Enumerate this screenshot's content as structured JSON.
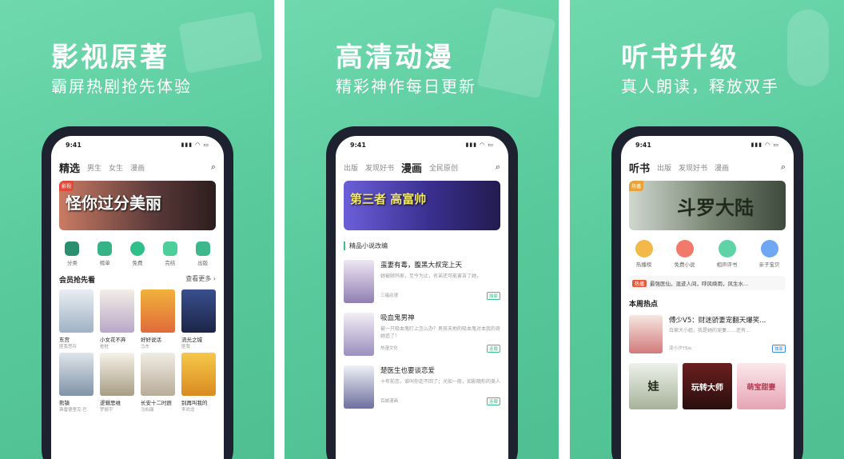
{
  "panels": [
    {
      "headline": "影视原著",
      "subtitle": "霸屏热剧抢先体验",
      "phone": {
        "time": "9:41",
        "tabs": [
          "精选",
          "男生",
          "女生",
          "漫画"
        ],
        "banner_text": "怪你过分美丽",
        "banner_tag": "影视",
        "shortcuts": [
          "分类",
          "榜单",
          "免费",
          "完结",
          "出版"
        ],
        "section_title": "会员抢先看",
        "section_more": "查看更多 ›",
        "books": [
          {
            "title": "东宫",
            "author": "匪我思存"
          },
          {
            "title": "小女花不弃",
            "author": "桩桩"
          },
          {
            "title": "好好说话",
            "author": "马东"
          },
          {
            "title": "流光之城",
            "author": "匪我"
          },
          {
            "title": "熊镇",
            "author": "弗雷德里克·巴"
          },
          {
            "title": "逻辑思维",
            "author": "罗振宇"
          },
          {
            "title": "长安十二时辰",
            "author": "马伯庸"
          },
          {
            "title": "别再叫我的",
            "author": "李尚龙"
          }
        ]
      }
    },
    {
      "headline": "高清动漫",
      "subtitle": "精彩神作每日更新",
      "phone": {
        "time": "9:41",
        "tabs": [
          "出版",
          "发现好书",
          "漫画",
          "全民原创"
        ],
        "banner_text": "第三者 高富帅",
        "list_title": "精品小说改编",
        "items": [
          {
            "title": "蛮妻有毒，腹黑大叔宠上天",
            "desc": "她被顾玛家，至今为止，名弟还可能害苦了她，",
            "publisher": "三福动漫",
            "badge": "独家"
          },
          {
            "title": "吸血鬼男神",
            "desc": "被一只吸血鬼盯上怎么办？男孩天地的吸血鬼对本我的奇她追了！",
            "publisher": "热漫文化",
            "badge": "连载"
          },
          {
            "title": "楚医生也要谈恋爱",
            "desc": "十年前恋，谁叫你走不回了；光如一般，如影随形的美人",
            "publisher": "百城漫画",
            "badge": "连载"
          }
        ]
      }
    },
    {
      "headline": "听书升级",
      "subtitle": "真人朗读，释放双手",
      "phone": {
        "time": "9:41",
        "tabs": [
          "听书",
          "出版",
          "发现好书",
          "漫画"
        ],
        "banner_text": "斗罗大陆",
        "banner_tag": "热播",
        "shortcuts": [
          "热播榜",
          "免费小说",
          "相声评书",
          "亲子宝贝"
        ],
        "notice_tag": "热播",
        "notice_text": "最强医仙，混迹人间，呼风唤雨，风生水...",
        "hot_title": "本周热点",
        "hot_item": {
          "title": "傅少V5：财迷骄妻宠翻天爆笑...",
          "desc": "白家大小姐，我是她的宠妻……还有…",
          "author": "凌小汐YSio",
          "badge": "独家"
        },
        "covers": [
          "娃",
          "玩转大师",
          "萌宝甜妻"
        ]
      }
    }
  ]
}
